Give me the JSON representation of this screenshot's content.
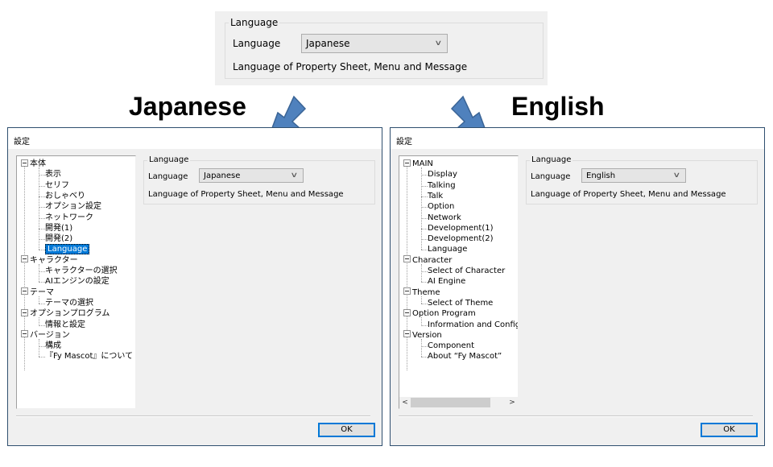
{
  "snippet": {
    "group_title": "Language",
    "label": "Language",
    "combo_value": "Japanese",
    "description": "Language of Property Sheet, Menu and Message"
  },
  "headings": {
    "japanese": "Japanese",
    "english": "English"
  },
  "colors": {
    "arrow": "#4f81bd",
    "arrow_stroke": "#3a6496",
    "selection": "#0078d7",
    "window_border": "#2f4f6f"
  },
  "windows": {
    "japanese": {
      "title": "設定",
      "tree": [
        {
          "label": "本体",
          "level": 0
        },
        {
          "label": "表示",
          "level": 1
        },
        {
          "label": "セリフ",
          "level": 1
        },
        {
          "label": "おしゃべり",
          "level": 1
        },
        {
          "label": "オプション設定",
          "level": 1
        },
        {
          "label": "ネットワーク",
          "level": 1
        },
        {
          "label": "開発(1)",
          "level": 1
        },
        {
          "label": "開発(2)",
          "level": 1
        },
        {
          "label": "Language",
          "level": 1,
          "selected": true
        },
        {
          "label": "キャラクター",
          "level": 0
        },
        {
          "label": "キャラクターの選択",
          "level": 1
        },
        {
          "label": "AIエンジンの設定",
          "level": 1
        },
        {
          "label": "テーマ",
          "level": 0
        },
        {
          "label": "テーマの選択",
          "level": 1
        },
        {
          "label": "オプションプログラム",
          "level": 0
        },
        {
          "label": "情報と設定",
          "level": 1
        },
        {
          "label": "バージョン",
          "level": 0
        },
        {
          "label": "構成",
          "level": 1
        },
        {
          "label": "『Fy Mascot』について",
          "level": 1
        }
      ],
      "panel": {
        "group_title": "Language",
        "label": "Language",
        "combo_value": "Japanese",
        "description": "Language of Property Sheet, Menu and Message"
      },
      "ok_label": "OK"
    },
    "english": {
      "title": "設定",
      "tree": [
        {
          "label": "MAIN",
          "level": 0
        },
        {
          "label": "Display",
          "level": 1
        },
        {
          "label": "Talking",
          "level": 1
        },
        {
          "label": "Talk",
          "level": 1
        },
        {
          "label": "Option",
          "level": 1
        },
        {
          "label": "Network",
          "level": 1
        },
        {
          "label": "Development(1)",
          "level": 1
        },
        {
          "label": "Development(2)",
          "level": 1
        },
        {
          "label": "Language",
          "level": 1
        },
        {
          "label": "Character",
          "level": 0
        },
        {
          "label": "Select of Character",
          "level": 1
        },
        {
          "label": "AI Engine",
          "level": 1
        },
        {
          "label": "Theme",
          "level": 0
        },
        {
          "label": "Select of Theme",
          "level": 1
        },
        {
          "label": "Option Program",
          "level": 0
        },
        {
          "label": "Information and Configu",
          "level": 1
        },
        {
          "label": "Version",
          "level": 0
        },
        {
          "label": "Component",
          "level": 1
        },
        {
          "label": "About “Fy Mascot”",
          "level": 1
        }
      ],
      "panel": {
        "group_title": "Language",
        "label": "Language",
        "combo_value": "English",
        "description": "Language of Property Sheet, Menu and Message"
      },
      "scrollbar": {
        "left_arrow": "<",
        "right_arrow": ">"
      },
      "ok_label": "OK"
    }
  }
}
